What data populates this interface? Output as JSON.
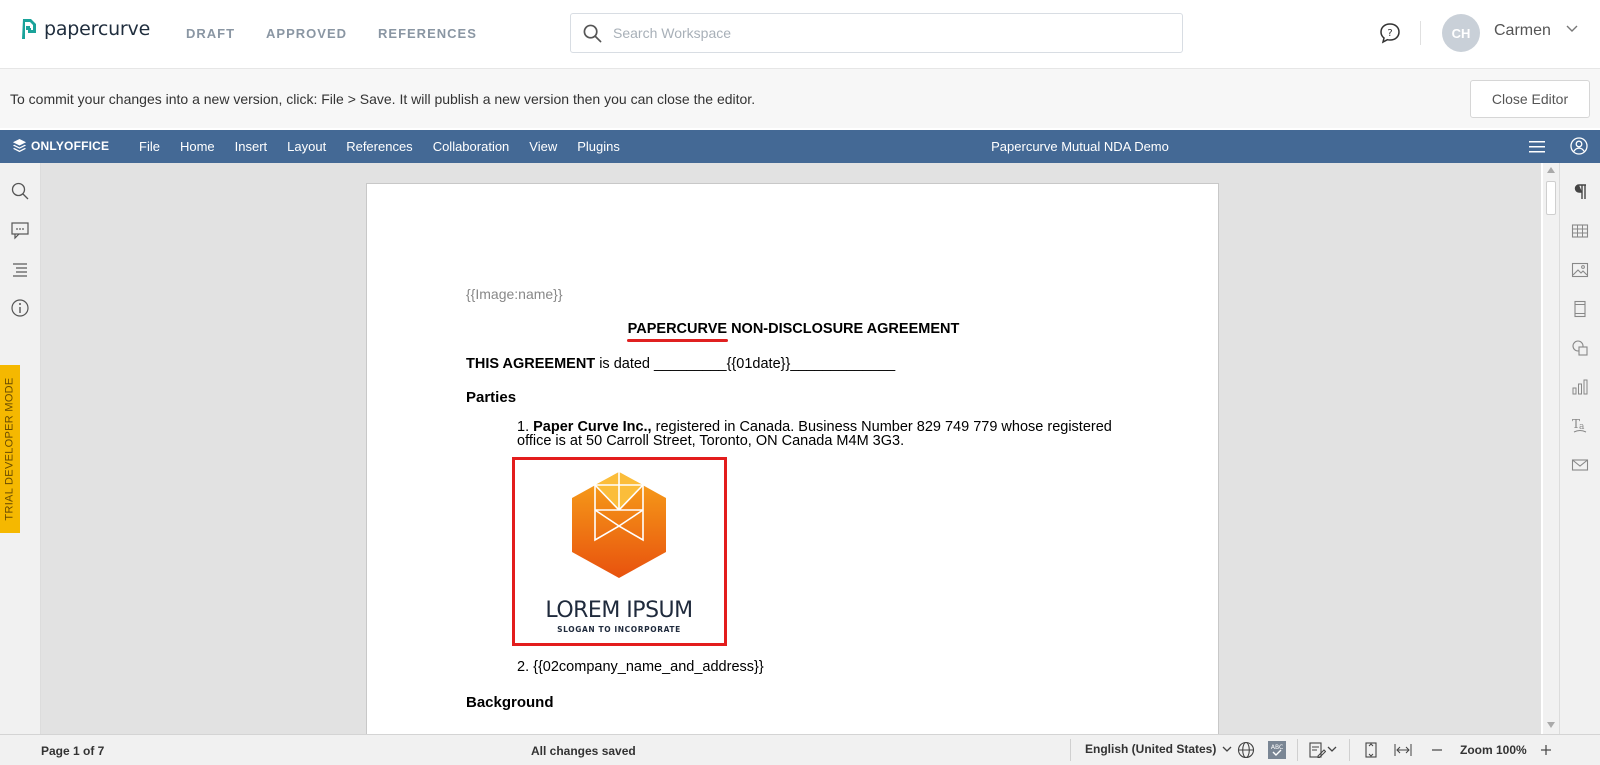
{
  "app": {
    "logo_text": "papercurve",
    "nav": [
      "DRAFT",
      "APPROVED",
      "REFERENCES"
    ],
    "search_placeholder": "Search Workspace",
    "user": {
      "initials": "CH",
      "name": "Carmen"
    }
  },
  "infobar": {
    "message": "To commit your changes into a new version, click: File > Save. It will publish a new version then you can close the editor.",
    "close_button": "Close Editor"
  },
  "editor_toolbar": {
    "brand": "ONLYOFFICE",
    "menu": [
      "File",
      "Home",
      "Insert",
      "Layout",
      "References",
      "Collaboration",
      "View",
      "Plugins"
    ],
    "document_title": "Papercurve Mutual NDA Demo"
  },
  "trial_badge": "TRIAL DEVELOPER MODE",
  "document": {
    "image_placeholder": "{{Image:name}}",
    "title_brand": "PAPERCURVE",
    "title_rest": " NON-DISCLOSURE AGREEMENT",
    "agreement_bold": "THIS AGREEMENT",
    "agreement_rest": " is dated _________{{01date}}_____________",
    "parties_heading": "Parties",
    "item1_number": "1. ",
    "item1_bold": "Paper Curve Inc.,",
    "item1_rest": " registered in Canada. Business Number 829 749 779 whose registered office is at 50 Carroll Street, Toronto, ON Canada M4M 3G3.",
    "logo_main": "LOREM IPSUM",
    "logo_slogan": "SLOGAN TO INCORPORATE",
    "item2": "2. {{02company_name_and_address}}",
    "background_heading": "Background"
  },
  "statusbar": {
    "page": "Page 1 of 7",
    "saved": "All changes saved",
    "language": "English (United States)",
    "zoom": "Zoom 100%"
  },
  "colors": {
    "editor_bar": "#446995",
    "trial_badge": "#f5b800",
    "highlight_box": "#e31d1d",
    "logo_orange": "#f07a10"
  }
}
